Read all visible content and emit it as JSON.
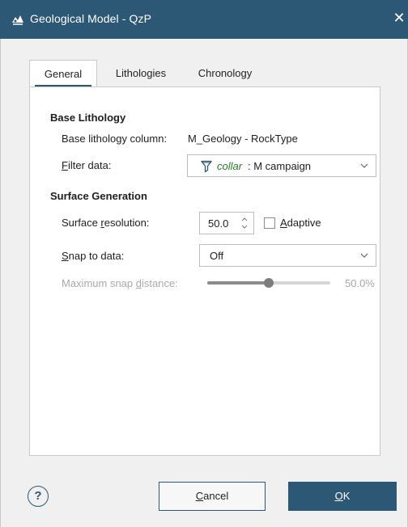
{
  "window": {
    "title": "Geological Model - QzP",
    "close_glyph": "✕"
  },
  "tabs": [
    {
      "label": "General",
      "active": true
    },
    {
      "label": "Lithologies",
      "active": false
    },
    {
      "label": "Chronology",
      "active": false
    }
  ],
  "base_lithology": {
    "heading": "Base Lithology",
    "column_label": "Base lithology column:",
    "column_value": "M_Geology - RockType",
    "filter_label_pre": "",
    "filter_label_mn": "F",
    "filter_label_post": "ilter data:",
    "filter_key": "collar",
    "filter_rest": ": M campaign"
  },
  "surface_generation": {
    "heading": "Surface Generation",
    "resolution_label_pre": "Surface ",
    "resolution_label_mn": "r",
    "resolution_label_post": "esolution:",
    "resolution_value": "50.0",
    "adaptive_pre": "",
    "adaptive_mn": "A",
    "adaptive_post": "daptive",
    "adaptive_checked": false,
    "snap_label_pre": "",
    "snap_label_mn": "S",
    "snap_label_post": "nap to data:",
    "snap_value": "Off",
    "max_snap_pre": "Maximum snap ",
    "max_snap_mn": "d",
    "max_snap_post": "istance:",
    "max_snap_value_text": "50.0%",
    "max_snap_fraction": 0.5,
    "max_snap_enabled": false
  },
  "footer": {
    "help_glyph": "?",
    "cancel_mn": "C",
    "cancel_rest": "ancel",
    "ok_mn": "O",
    "ok_rest": "K"
  },
  "colors": {
    "titlebar": "#2c5775",
    "accent": "#2c5775",
    "filter_key": "#2a7a2a",
    "disabled_text": "#a9a9a9"
  },
  "icons": {
    "app": "geological-model-icon",
    "close": "close-icon",
    "filter": "filter-funnel-icon",
    "dropdown": "chevron-down-icon",
    "spin": "spin-arrows-icon",
    "help": "help-circle-icon"
  }
}
